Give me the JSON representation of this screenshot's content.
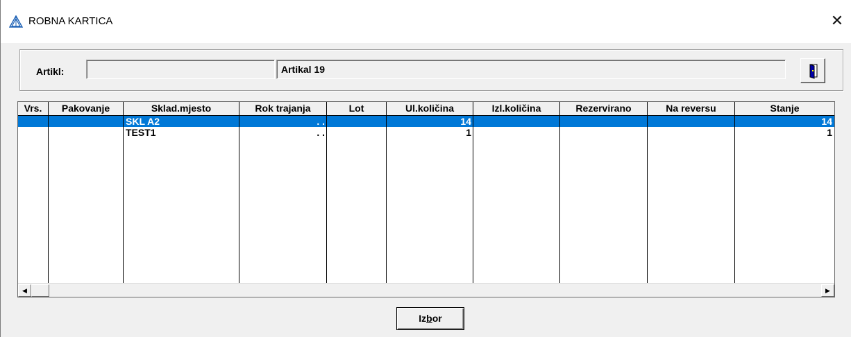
{
  "window": {
    "title": "ROBNA KARTICA",
    "close_glyph": "✕",
    "icon": "app-logo-icon"
  },
  "artikl": {
    "label": "Artikl:",
    "code_value": "",
    "name_value": "Artikal 19",
    "exit_button_icon": "door-exit-icon"
  },
  "table": {
    "columns": [
      "Vrs.",
      "Pakovanje",
      "Sklad.mjesto",
      "Rok trajanja",
      "Lot",
      "Ul.količina",
      "Izl.količina",
      "Rezervirano",
      "Na reversu",
      "Stanje"
    ],
    "rows": [
      {
        "vrs": "",
        "pakovanje": "",
        "sklad_mjesto": "SKL A2",
        "rok_trajanja": ". .",
        "lot": "",
        "ul_kolicina": "14",
        "izl_kolicina": "",
        "rezervirano": "",
        "na_reversu": "",
        "stanje": "14",
        "selected": true
      },
      {
        "vrs": "",
        "pakovanje": "",
        "sklad_mjesto": "TEST1",
        "rok_trajanja": ". .",
        "lot": "",
        "ul_kolicina": "1",
        "izl_kolicina": "",
        "rezervirano": "",
        "na_reversu": "",
        "stanje": "1",
        "selected": false
      }
    ],
    "selection_color": "#0078d7"
  },
  "scrollbar": {
    "left_arrow": "◀",
    "right_arrow": "▶"
  },
  "izbor_button": {
    "label_prefix": "Iz",
    "label_mnemonic": "b",
    "label_suffix": "or"
  }
}
